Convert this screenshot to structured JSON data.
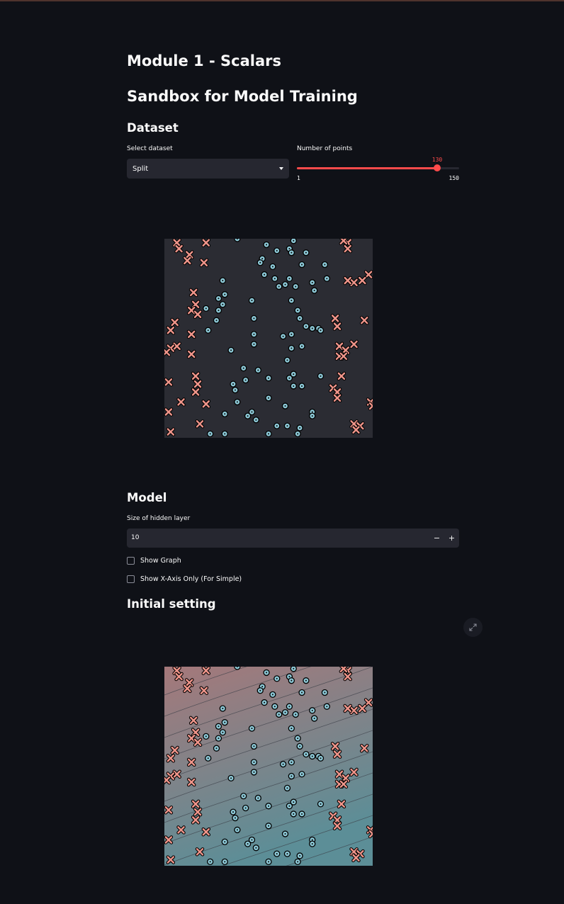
{
  "header": {
    "module_title": "Module 1 - Scalars",
    "sandbox_title": "Sandbox for Model Training"
  },
  "dataset": {
    "heading": "Dataset",
    "select_label": "Select dataset",
    "selected": "Split",
    "points_label": "Number of points",
    "points_value": "130",
    "points_min": "1",
    "points_max": "150",
    "points_fraction": 0.866
  },
  "model": {
    "heading": "Model",
    "hidden_label": "Size of hidden layer",
    "hidden_value": "10",
    "minus": "−",
    "plus": "+",
    "show_graph": "Show Graph",
    "show_x_only": "Show X-Axis Only (For Simple)"
  },
  "initial": {
    "heading": "Initial setting"
  },
  "icons": {
    "dropdown": "chevron-down-icon",
    "expand": "fullscreen-icon"
  },
  "colors": {
    "accent": "#ff4b4b",
    "class0_marker": "#f0958a",
    "class1_marker": "#8cc8d6",
    "plot_bg": "#2b2c33",
    "grad_top": "#a5787a",
    "grad_bottom": "#5c8e97"
  },
  "chart_data": {
    "type": "scatter",
    "xlim": [
      0,
      1
    ],
    "ylim": [
      0,
      1
    ],
    "series": [
      {
        "marker": "x",
        "points": [
          [
            0.06,
            0.98
          ],
          [
            0.2,
            0.98
          ],
          [
            0.07,
            0.95
          ],
          [
            0.12,
            0.92
          ],
          [
            0.11,
            0.89
          ],
          [
            0.19,
            0.88
          ],
          [
            0.88,
            0.98
          ],
          [
            0.86,
            0.99
          ],
          [
            0.88,
            0.95
          ],
          [
            0.98,
            0.82
          ],
          [
            0.91,
            0.78
          ],
          [
            0.88,
            0.79
          ],
          [
            0.95,
            0.79
          ],
          [
            0.14,
            0.73
          ],
          [
            0.15,
            0.67
          ],
          [
            0.13,
            0.64
          ],
          [
            0.16,
            0.62
          ],
          [
            0.05,
            0.58
          ],
          [
            0.03,
            0.54
          ],
          [
            0.13,
            0.52
          ],
          [
            0.06,
            0.46
          ],
          [
            0.03,
            0.45
          ],
          [
            0.01,
            0.43
          ],
          [
            0.13,
            0.42
          ],
          [
            0.82,
            0.6
          ],
          [
            0.83,
            0.56
          ],
          [
            0.96,
            0.59
          ],
          [
            0.84,
            0.46
          ],
          [
            0.87,
            0.44
          ],
          [
            0.91,
            0.47
          ],
          [
            0.84,
            0.41
          ],
          [
            0.86,
            0.41
          ],
          [
            0.85,
            0.31
          ],
          [
            0.02,
            0.28
          ],
          [
            0.15,
            0.31
          ],
          [
            0.16,
            0.27
          ],
          [
            0.15,
            0.23
          ],
          [
            0.81,
            0.25
          ],
          [
            0.83,
            0.23
          ],
          [
            0.83,
            0.2
          ],
          [
            0.08,
            0.18
          ],
          [
            0.2,
            0.17
          ],
          [
            0.02,
            0.13
          ],
          [
            0.99,
            0.18
          ],
          [
            1.0,
            0.16
          ],
          [
            0.17,
            0.07
          ],
          [
            0.91,
            0.07
          ],
          [
            0.94,
            0.06
          ],
          [
            0.92,
            0.04
          ],
          [
            0.03,
            0.03
          ]
        ]
      },
      {
        "marker": "o",
        "points": [
          [
            0.35,
            1.0
          ],
          [
            0.49,
            0.97
          ],
          [
            0.62,
            0.99
          ],
          [
            0.6,
            0.95
          ],
          [
            0.54,
            0.94
          ],
          [
            0.68,
            0.93
          ],
          [
            0.61,
            0.93
          ],
          [
            0.47,
            0.9
          ],
          [
            0.77,
            0.87
          ],
          [
            0.46,
            0.88
          ],
          [
            0.66,
            0.87
          ],
          [
            0.52,
            0.86
          ],
          [
            0.48,
            0.82
          ],
          [
            0.53,
            0.8
          ],
          [
            0.6,
            0.8
          ],
          [
            0.78,
            0.8
          ],
          [
            0.71,
            0.78
          ],
          [
            0.58,
            0.77
          ],
          [
            0.63,
            0.76
          ],
          [
            0.55,
            0.76
          ],
          [
            0.72,
            0.74
          ],
          [
            0.28,
            0.79
          ],
          [
            0.29,
            0.72
          ],
          [
            0.26,
            0.7
          ],
          [
            0.28,
            0.67
          ],
          [
            0.42,
            0.69
          ],
          [
            0.61,
            0.69
          ],
          [
            0.26,
            0.64
          ],
          [
            0.2,
            0.65
          ],
          [
            0.64,
            0.64
          ],
          [
            0.65,
            0.6
          ],
          [
            0.43,
            0.6
          ],
          [
            0.25,
            0.59
          ],
          [
            0.74,
            0.55
          ],
          [
            0.71,
            0.55
          ],
          [
            0.75,
            0.54
          ],
          [
            0.68,
            0.56
          ],
          [
            0.61,
            0.52
          ],
          [
            0.43,
            0.52
          ],
          [
            0.21,
            0.54
          ],
          [
            0.57,
            0.51
          ],
          [
            0.43,
            0.47
          ],
          [
            0.66,
            0.46
          ],
          [
            0.61,
            0.45
          ],
          [
            0.32,
            0.44
          ],
          [
            0.59,
            0.39
          ],
          [
            0.38,
            0.35
          ],
          [
            0.45,
            0.34
          ],
          [
            0.62,
            0.32
          ],
          [
            0.6,
            0.3
          ],
          [
            0.5,
            0.3
          ],
          [
            0.75,
            0.31
          ],
          [
            0.39,
            0.29
          ],
          [
            0.33,
            0.27
          ],
          [
            0.62,
            0.26
          ],
          [
            0.66,
            0.26
          ],
          [
            0.34,
            0.24
          ],
          [
            0.5,
            0.2
          ],
          [
            0.35,
            0.18
          ],
          [
            0.58,
            0.16
          ],
          [
            0.71,
            0.13
          ],
          [
            0.42,
            0.13
          ],
          [
            0.71,
            0.11
          ],
          [
            0.29,
            0.12
          ],
          [
            0.44,
            0.09
          ],
          [
            0.54,
            0.06
          ],
          [
            0.59,
            0.06
          ],
          [
            0.65,
            0.05
          ],
          [
            0.22,
            0.02
          ],
          [
            0.29,
            0.02
          ],
          [
            0.5,
            0.02
          ],
          [
            0.64,
            0.02
          ],
          [
            0.4,
            0.11
          ]
        ]
      }
    ]
  }
}
